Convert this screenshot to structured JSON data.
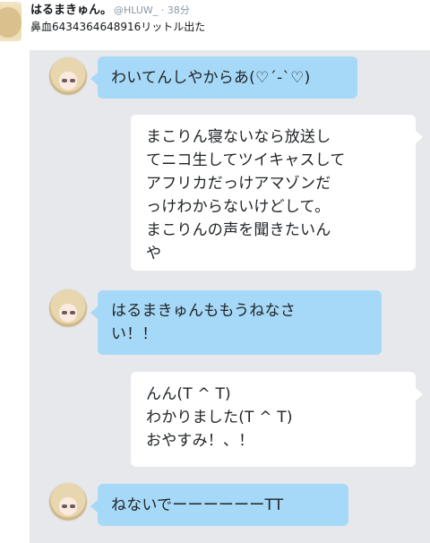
{
  "tweet": {
    "display_name": "はるまきゅん。",
    "handle_time": "@HLUW_ · 38分",
    "text": "鼻血6434364648916リットル出た"
  },
  "messages": [
    {
      "side": "left",
      "text": "わいてんしやからあ(♡´-`♡)"
    },
    {
      "side": "right",
      "text": "まこりん寝ないなら放送し\nてニコ生してツイキャスして\nアフリカだっけアマゾンだ\nっけわからないけどして。\nまこりんの声を聞きたいん\nや"
    },
    {
      "side": "left",
      "text": "はるまきゅんももうねなさ\nい！！"
    },
    {
      "side": "right",
      "text": "んん(T ^ T)\nわかりました(T ^ T)\nおやすみ！、！"
    },
    {
      "side": "left",
      "text": "ねないでーーーーーーTT"
    }
  ],
  "icons": {
    "header_avatar": "anime-profile-avatar",
    "chat_avatar": "anime-chat-avatar"
  },
  "colors": {
    "panel_background": "#e6e8eb",
    "left_bubble": "#a6d9f7",
    "right_bubble": "#ffffff",
    "meta_text": "#8899a6"
  }
}
